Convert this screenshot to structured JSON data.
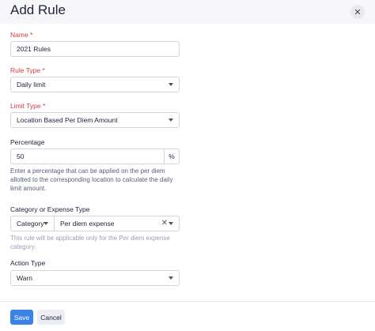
{
  "dialog": {
    "title": "Add Rule",
    "close_icon": "close-icon"
  },
  "form": {
    "name": {
      "label": "Name *",
      "value": "2021 Rules"
    },
    "rule_type": {
      "label": "Rule Type *",
      "value": "Daily limit"
    },
    "limit_type": {
      "label": "Limit Type *",
      "value": "Location Based Per Diem Amount"
    },
    "percentage": {
      "label": "Percentage",
      "value": "50",
      "suffix": "%",
      "help": "Enter a percentage that can be applied on the per diem allotted to the corresponding location to calculate the daily limit amount."
    },
    "category": {
      "label": "Category or Expense Type",
      "type_value": "Category",
      "value": "Per diem expense",
      "help": "This rule will be applicable only for the Per diem expense category."
    },
    "action_type": {
      "label": "Action Type",
      "value": "Warn"
    }
  },
  "footer": {
    "save_label": "Save",
    "cancel_label": "Cancel"
  },
  "colors": {
    "primary": "#3b82e6",
    "required": "#d23b3b"
  }
}
